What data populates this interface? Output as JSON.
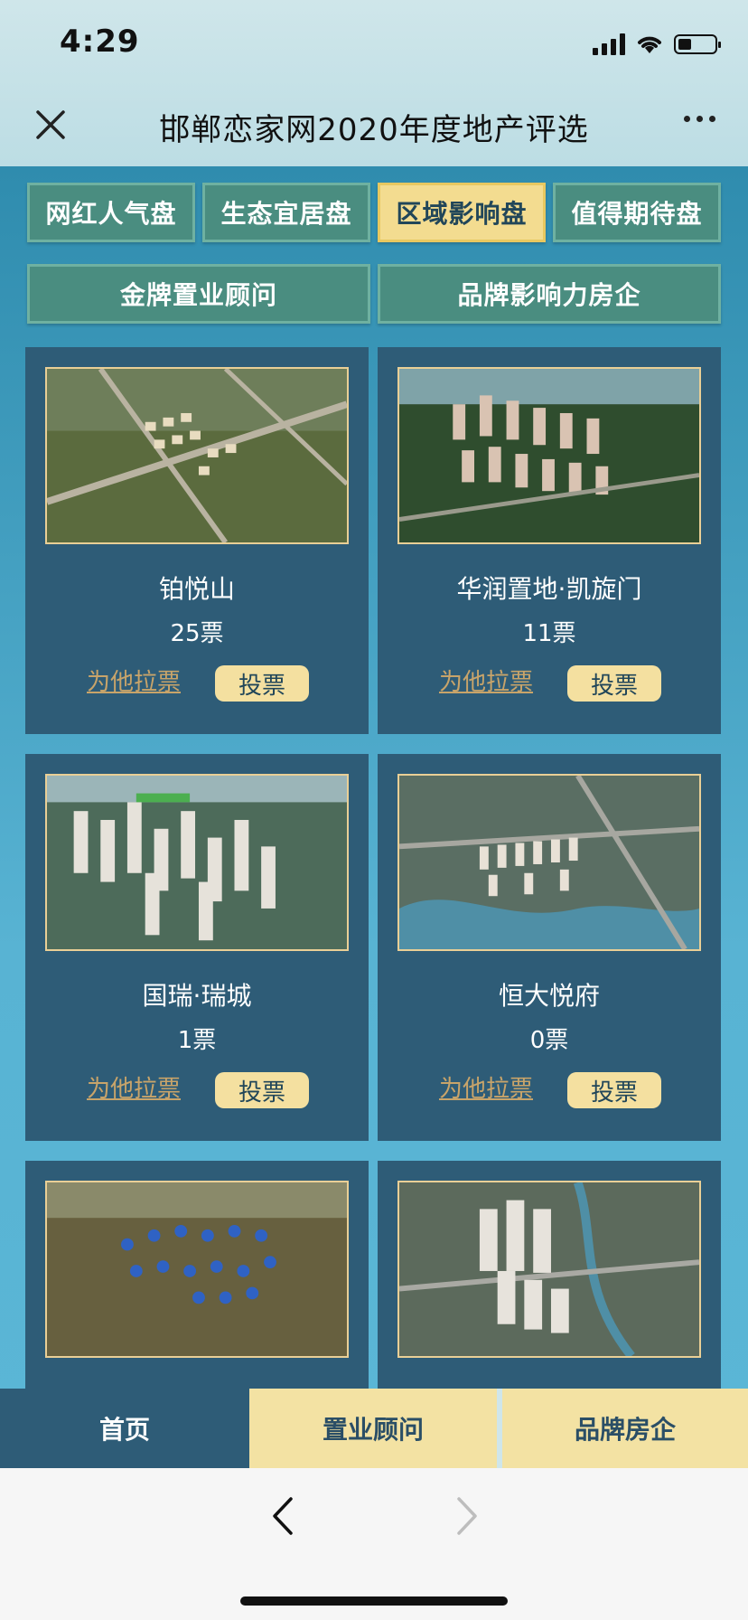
{
  "status": {
    "time": "4:29"
  },
  "header": {
    "title": "邯郸恋家网2020年度地产评选"
  },
  "category_tabs": [
    {
      "label": "网红人气盘",
      "active": false
    },
    {
      "label": "生态宜居盘",
      "active": false
    },
    {
      "label": "区域影响盘",
      "active": true
    },
    {
      "label": "值得期待盘",
      "active": false
    },
    {
      "label": "金牌置业顾问",
      "active": false
    },
    {
      "label": "品牌影响力房企",
      "active": false
    }
  ],
  "cards": [
    {
      "name": "铂悦山",
      "votes": "25票",
      "canvass_label": "为他拉票",
      "vote_label": "投票"
    },
    {
      "name": "华润置地·凯旋门",
      "votes": "11票",
      "canvass_label": "为他拉票",
      "vote_label": "投票"
    },
    {
      "name": "国瑞·瑞城",
      "votes": "1票",
      "canvass_label": "为他拉票",
      "vote_label": "投票"
    },
    {
      "name": "恒大悦府",
      "votes": "0票",
      "canvass_label": "为他拉票",
      "vote_label": "投票"
    },
    {
      "name": "",
      "votes": "",
      "canvass_label": "",
      "vote_label": ""
    },
    {
      "name": "",
      "votes": "",
      "canvass_label": "",
      "vote_label": ""
    }
  ],
  "bottom_tabs": [
    {
      "label": "首页",
      "active": true
    },
    {
      "label": "置业顾问",
      "active": false
    },
    {
      "label": "品牌房企",
      "active": false
    }
  ],
  "colors": {
    "accent_gold": "#f3dc90",
    "card_bg": "#2e5c77",
    "tab_green": "#4a8d80"
  }
}
